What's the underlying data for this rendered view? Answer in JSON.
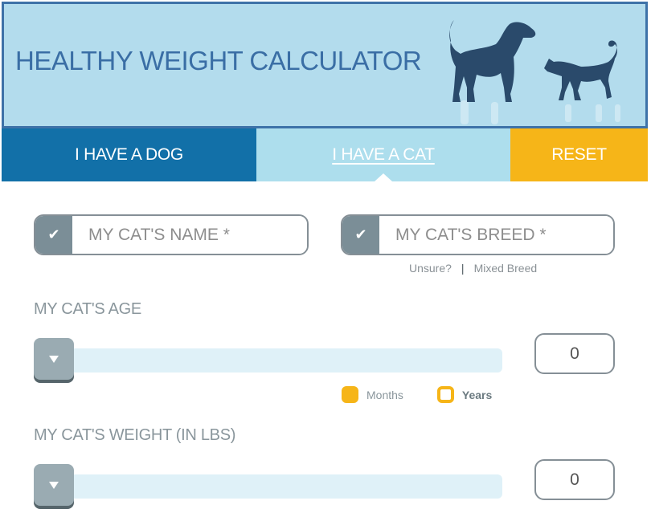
{
  "header": {
    "title": "HEALTHY WEIGHT CALCULATOR",
    "art_icon": "dog-and-cat-silhouette"
  },
  "colors": {
    "header_bg": "#b3dced",
    "header_border": "#3e72a8",
    "dog_tab": "#1270a8",
    "cat_tab": "#addeed",
    "reset": "#f6b518",
    "check_bg": "#7b8e97",
    "slider_track": "#dff1f8",
    "slider_thumb": "#9aabb2"
  },
  "tabs": [
    {
      "label": "I HAVE A DOG",
      "active": false
    },
    {
      "label": "I HAVE A CAT",
      "active": true
    },
    {
      "label": "RESET",
      "active": false
    }
  ],
  "form": {
    "name": {
      "placeholder": "MY CAT'S NAME *",
      "value": "",
      "icon": "check-icon"
    },
    "breed": {
      "placeholder": "MY CAT'S BREED *",
      "value": "",
      "icon": "check-icon"
    },
    "breed_links": {
      "unsure": "Unsure?",
      "separator": "|",
      "mixed": "Mixed Breed"
    },
    "age": {
      "label": "MY CAT'S AGE",
      "value": "0",
      "slider_fraction": 0,
      "units": [
        {
          "label": "Months",
          "selected": false
        },
        {
          "label": "Years",
          "selected": true
        }
      ]
    },
    "weight": {
      "label": "MY CAT'S WEIGHT (IN LBS)",
      "value": "0",
      "slider_fraction": 0
    }
  }
}
